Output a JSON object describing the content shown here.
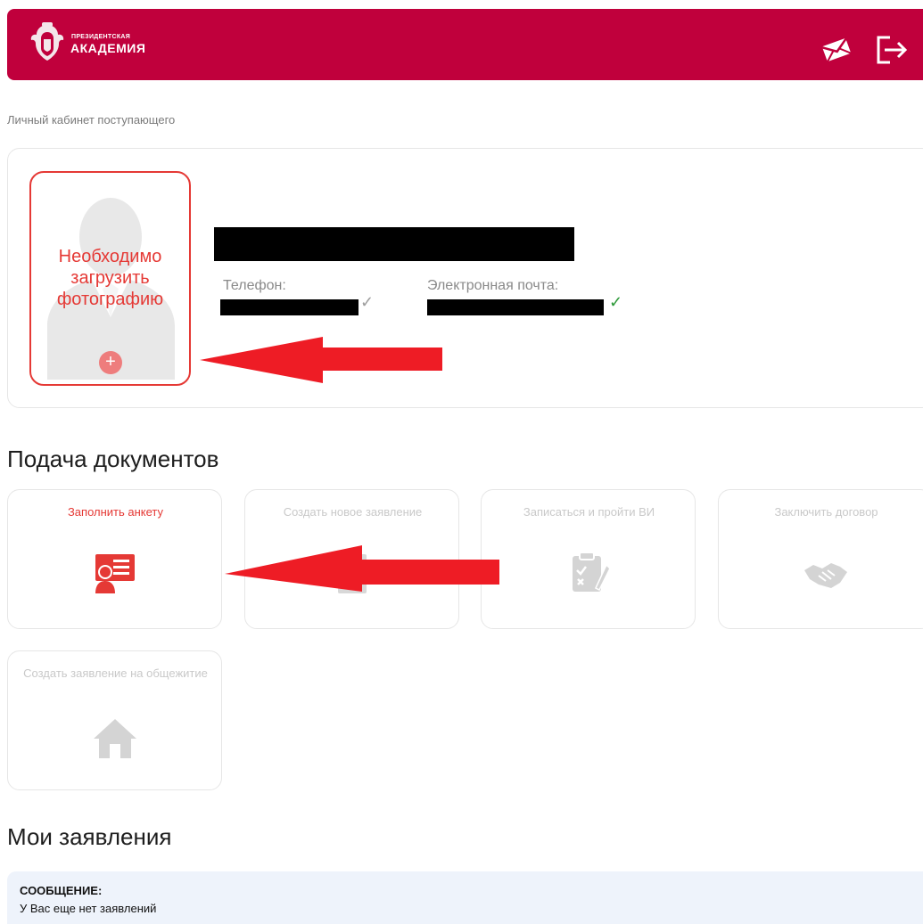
{
  "header": {
    "logo_small": "ПРЕЗИДЕНТСКАЯ",
    "logo_big": "АКАДЕМИЯ",
    "mail_icon": "envelope-icon",
    "logout_icon": "logout-icon"
  },
  "breadcrumb": "Личный кабинет поступающего",
  "profile": {
    "photo_message": "Необходимо загрузить фотографию",
    "add_symbol": "+",
    "phone_label": "Телефон:",
    "email_label": "Электронная почта:",
    "check_symbol": "✓"
  },
  "documents": {
    "title": "Подача документов",
    "tiles": [
      {
        "label": "Заполнить анкету",
        "icon": "form-person-icon"
      },
      {
        "label": "Создать новое заявление",
        "icon": "new-application-icon"
      },
      {
        "label": "Записаться и пройти ВИ",
        "icon": "checklist-icon"
      },
      {
        "label": "Заключить договор",
        "icon": "handshake-icon"
      },
      {
        "label": "Создать заявление на общежитие",
        "icon": "house-icon"
      }
    ]
  },
  "applications": {
    "title": "Мои заявления",
    "message_title": "СООБЩЕНИЕ:",
    "message_text": "У Вас еще нет заявлений"
  },
  "colors": {
    "brand": "#c0003c",
    "accent_red": "#e53935",
    "disabled": "#c9c9c9",
    "success": "#2e9a3a",
    "message_bg": "#eef3fb"
  }
}
